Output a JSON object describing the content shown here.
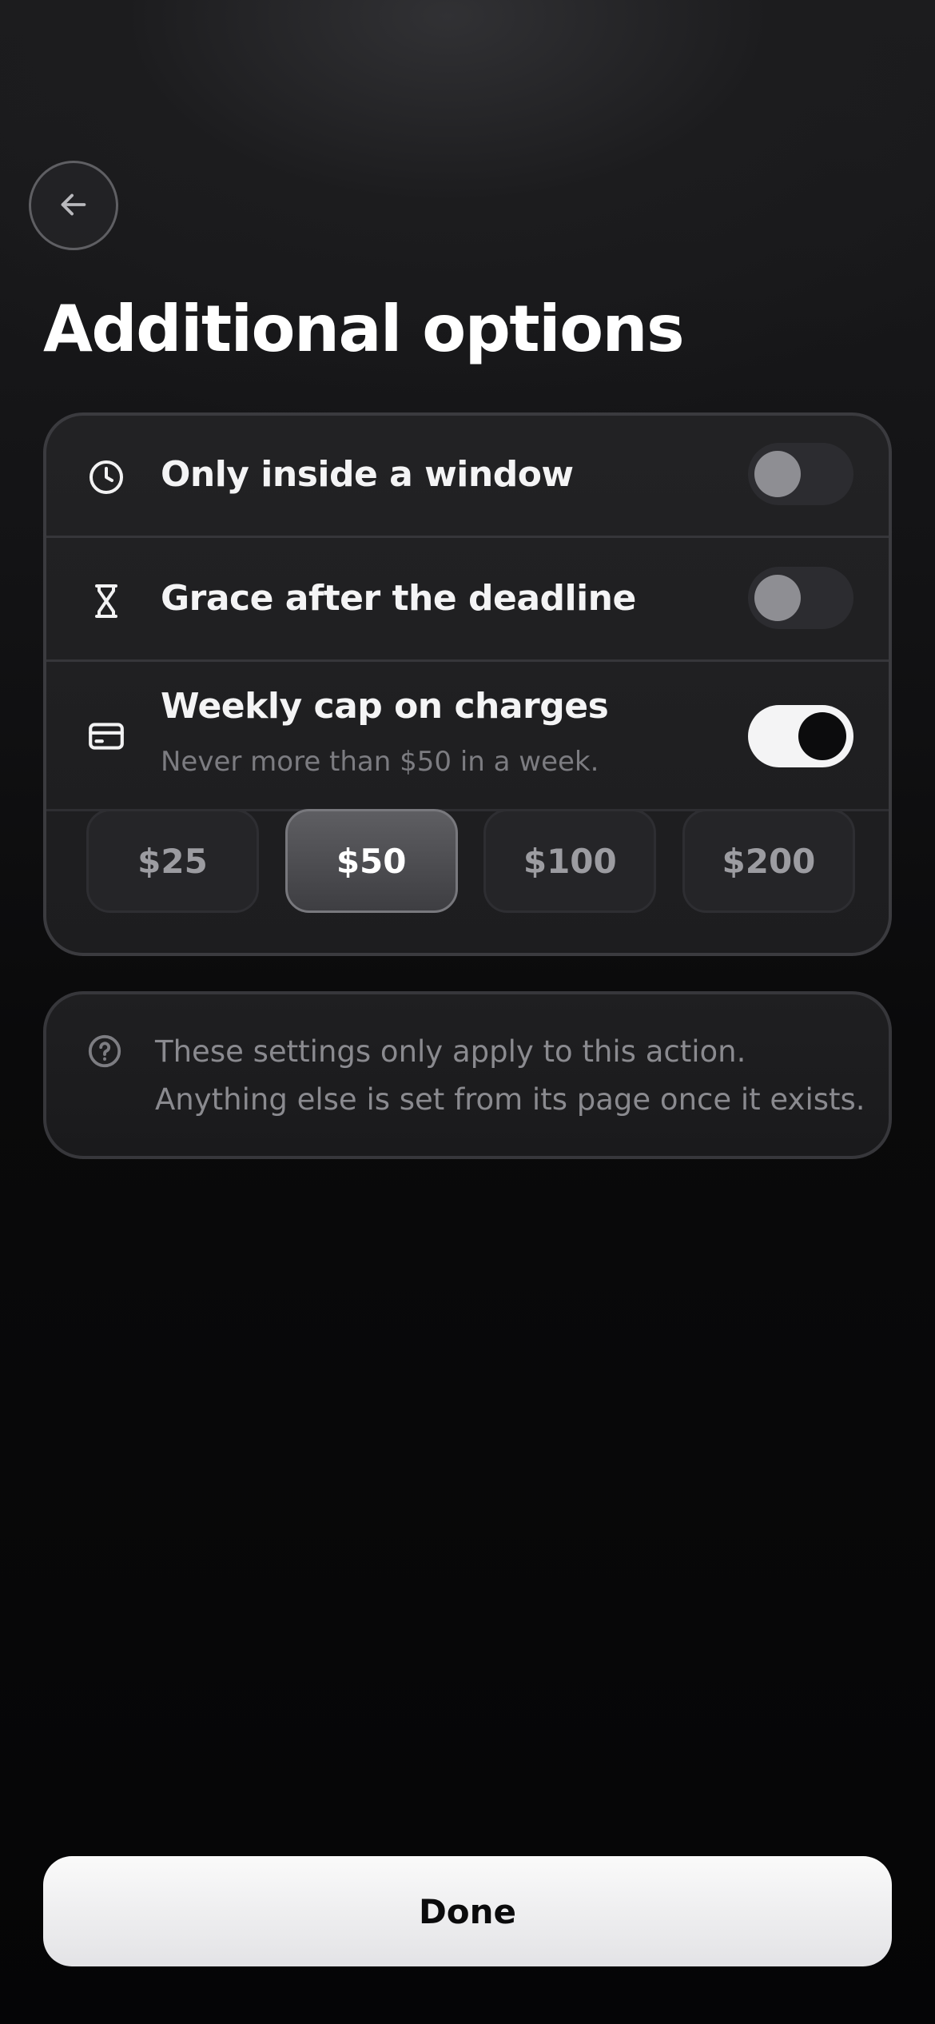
{
  "header": {
    "back_icon": "arrow-left-icon",
    "title": "Additional options"
  },
  "options": [
    {
      "icon": "clock-icon",
      "label": "Only inside a window",
      "enabled": false
    },
    {
      "icon": "hourglass-icon",
      "label": "Grace after the deadline",
      "enabled": false
    },
    {
      "icon": "credit-card-icon",
      "label": "Weekly cap on charges",
      "subtitle": "Never more than $50 in a week.",
      "enabled": true
    }
  ],
  "weekly_cap": {
    "amounts": [
      "$25",
      "$50",
      "$100",
      "$200"
    ],
    "selected": "$50"
  },
  "info": {
    "icon": "help-circle-icon",
    "text": "These settings only apply to this action. Anything else is set from its page once it exists."
  },
  "footer": {
    "done_label": "Done"
  },
  "colors": {
    "background": "#0a0a0b",
    "card": "#1f1f21",
    "toggle_on": "#f4f4f5",
    "toggle_off": "#2c2c30",
    "chip_selected": "#4e4e52"
  }
}
